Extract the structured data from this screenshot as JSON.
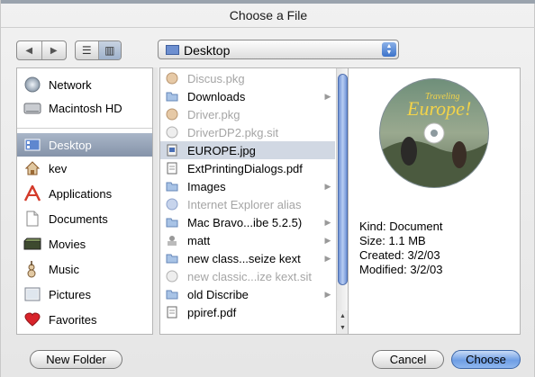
{
  "window": {
    "title": "Choose a File"
  },
  "toolbar": {
    "back_glyph": "◀",
    "forward_glyph": "▶",
    "list_view_glyph": "☰",
    "column_view_glyph": "▥",
    "location": "Desktop",
    "location_icon": "desktop-icon",
    "arrows_glyph": "▲▼"
  },
  "sidebar": {
    "items": [
      {
        "label": "Network",
        "icon": "network-icon"
      },
      {
        "label": "Macintosh HD",
        "icon": "hard-drive-icon"
      },
      {
        "label": "Desktop",
        "icon": "desktop-icon",
        "selected": true
      },
      {
        "label": "kev",
        "icon": "home-icon"
      },
      {
        "label": "Applications",
        "icon": "applications-icon"
      },
      {
        "label": "Documents",
        "icon": "documents-icon"
      },
      {
        "label": "Movies",
        "icon": "movies-icon"
      },
      {
        "label": "Music",
        "icon": "music-icon"
      },
      {
        "label": "Pictures",
        "icon": "pictures-icon"
      },
      {
        "label": "Favorites",
        "icon": "favorites-heart-icon"
      }
    ]
  },
  "files": [
    {
      "name": "Discus.pkg",
      "icon": "package-icon",
      "dim": true
    },
    {
      "name": "Downloads",
      "icon": "folder-icon",
      "folder": true
    },
    {
      "name": "Driver.pkg",
      "icon": "package-icon",
      "dim": true
    },
    {
      "name": "DriverDP2.pkg.sit",
      "icon": "archive-icon",
      "dim": true
    },
    {
      "name": "EUROPE.jpg",
      "icon": "jpeg-icon",
      "selected": true
    },
    {
      "name": "ExtPrintingDialogs.pdf",
      "icon": "pdf-icon"
    },
    {
      "name": "Images",
      "icon": "folder-icon",
      "folder": true
    },
    {
      "name": "Internet Explorer alias",
      "icon": "alias-icon",
      "dim": true
    },
    {
      "name": "Mac Bravo...ibe 5.2.5)",
      "icon": "folder-icon",
      "folder": true
    },
    {
      "name": "matt",
      "icon": "user-folder-icon",
      "folder": true
    },
    {
      "name": "new class...seize kext",
      "icon": "folder-icon",
      "folder": true
    },
    {
      "name": "new classic...ize kext.sit",
      "icon": "archive-icon",
      "dim": true
    },
    {
      "name": "old Discribe",
      "icon": "folder-icon",
      "folder": true
    },
    {
      "name": "ppiref.pdf",
      "icon": "pdf-icon"
    }
  ],
  "preview": {
    "disc_title_1": "Traveling",
    "disc_title_2": "Europe!",
    "kind": "Kind: Document",
    "size": "Size: 1.1 MB",
    "created": "Created: 3/2/03",
    "modified": "Modified: 3/2/03"
  },
  "buttons": {
    "new_folder": "New Folder",
    "cancel": "Cancel",
    "choose": "Choose"
  },
  "colors": {
    "selection": "#8593a9",
    "accent": "#6f9ee5",
    "file_selection": "#d1d8e3"
  }
}
